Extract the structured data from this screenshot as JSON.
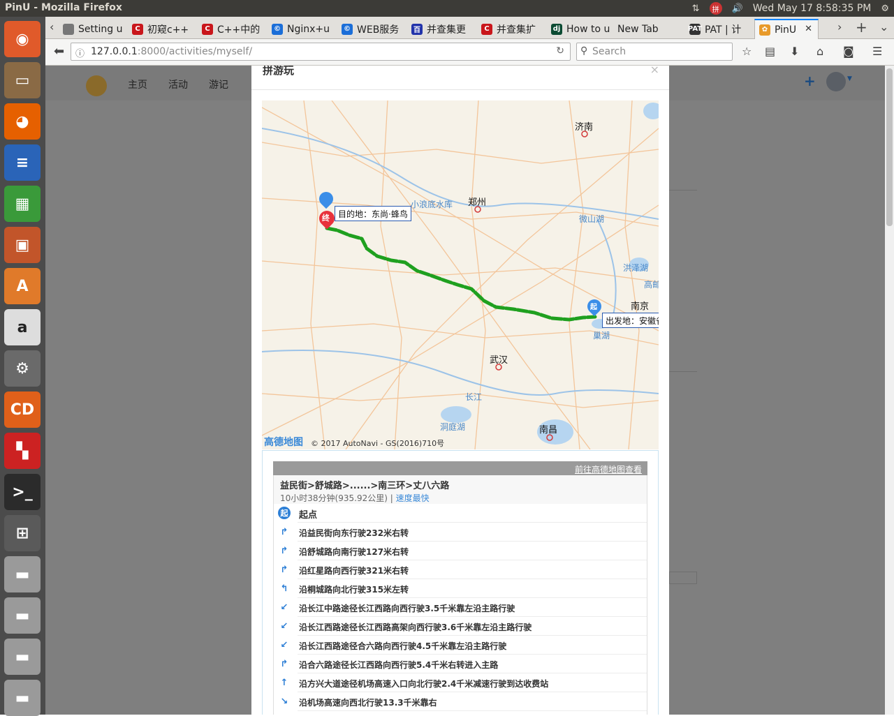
{
  "os": {
    "window_title": "PinU - Mozilla Firefox",
    "datetime": "Wed May 17  8:58:35 PM",
    "tray_icons": [
      "network-icon",
      "input-method-icon",
      "volume-icon",
      "settings-icon"
    ]
  },
  "launcher": {
    "items": [
      {
        "name": "ubuntu-dash-icon",
        "color": "#e05a2a"
      },
      {
        "name": "files-icon",
        "color": "#8a6a45"
      },
      {
        "name": "firefox-icon",
        "color": "#e66000"
      },
      {
        "name": "writer-icon",
        "color": "#2a64b8"
      },
      {
        "name": "calc-icon",
        "color": "#3a9a3a"
      },
      {
        "name": "impress-icon",
        "color": "#c2552a"
      },
      {
        "name": "software-center-icon",
        "color": "#e07a2a"
      },
      {
        "name": "amazon-icon",
        "color": "#dddddd"
      },
      {
        "name": "system-settings-icon",
        "color": "#6a6a6a"
      },
      {
        "name": "disc-icon",
        "color": "#e0601a"
      },
      {
        "name": "workspaces-icon",
        "color": "#cc2222"
      },
      {
        "name": "terminal-icon",
        "color": "#2b2b2b"
      },
      {
        "name": "workspace-switcher-icon",
        "color": "#5a5a5a"
      },
      {
        "name": "drive-icon",
        "color": "#9a9a9a"
      },
      {
        "name": "drive-icon",
        "color": "#9a9a9a"
      },
      {
        "name": "drive-icon",
        "color": "#9a9a9a"
      },
      {
        "name": "drive-icon",
        "color": "#9a9a9a"
      }
    ]
  },
  "browser": {
    "tabs": [
      {
        "label": "Setting u",
        "icon": "page-icon",
        "icon_color": "#777777",
        "active": false
      },
      {
        "label": "初窥c++",
        "icon": "csdn-icon",
        "icon_color": "#c9161b",
        "icon_text": "C",
        "active": false
      },
      {
        "label": "C++中的",
        "icon": "csdn-icon",
        "icon_color": "#c9161b",
        "icon_text": "C",
        "active": false
      },
      {
        "label": "Nginx+u",
        "icon": "blog-icon",
        "icon_color": "#1b6ed8",
        "icon_text": "©",
        "active": false
      },
      {
        "label": "WEB服务",
        "icon": "blog-icon",
        "icon_color": "#1b6ed8",
        "icon_text": "©",
        "active": false
      },
      {
        "label": "并查集更",
        "icon": "site-icon",
        "icon_color": "#2233aa",
        "icon_text": "百",
        "active": false
      },
      {
        "label": "并查集扩",
        "icon": "csdn-icon",
        "icon_color": "#c9161b",
        "icon_text": "C",
        "active": false
      },
      {
        "label": "How to u",
        "icon": "django-icon",
        "icon_color": "#0c4b33",
        "icon_text": "dj",
        "active": false
      },
      {
        "label": "New Tab",
        "icon": "",
        "icon_color": "",
        "icon_text": "",
        "active": false
      },
      {
        "label": "PAT | 计",
        "icon": "pat-icon",
        "icon_color": "#333333",
        "icon_text": "PAT",
        "active": false
      },
      {
        "label": "PinU",
        "icon": "pinu-icon",
        "icon_color": "#e89a2a",
        "icon_text": "✿",
        "active": true
      }
    ],
    "url_host": "127.0.0.1",
    "url_rest": ":8000/activities/myself/",
    "search_placeholder": "Search"
  },
  "site": {
    "nav": [
      "主页",
      "活动",
      "游记"
    ]
  },
  "modal": {
    "title": "拼游玩",
    "close": "×"
  },
  "map": {
    "cities": [
      {
        "name": "济南"
      },
      {
        "name": "郑州"
      },
      {
        "name": "南京"
      },
      {
        "name": "武汉"
      },
      {
        "name": "南昌"
      }
    ],
    "water": [
      "小浪底水库",
      "微山湖",
      "洪泽湖",
      "高邮",
      "巢湖",
      "长江",
      "洞庭湖"
    ],
    "destination_label": "目的地：东尚·蜂鸟",
    "origin_label": "出发地：安徽省",
    "end_marker": "终",
    "start_marker": "起",
    "attribution_logo": "高德地图",
    "attribution": "© 2017 AutoNavi - GS(2016)710号",
    "route_color": "#1fa01f"
  },
  "route": {
    "view_link": "前往高德地图查看",
    "path": "益民街>舒城路>......>南三环>丈八六路",
    "duration_distance": "10小时38分钟(935.92公里)",
    "policy": "速度最快",
    "steps": [
      {
        "icon": "start-icon",
        "text": "起点"
      },
      {
        "icon": "turn-right-icon",
        "text": "沿益民街向东行驶232米右转"
      },
      {
        "icon": "turn-right-icon",
        "text": "沿舒城路向南行驶127米右转"
      },
      {
        "icon": "turn-right-icon",
        "text": "沿红星路向西行驶321米右转"
      },
      {
        "icon": "turn-left-icon",
        "text": "沿桐城路向北行驶315米左转"
      },
      {
        "icon": "keep-left-icon",
        "text": "沿长江中路途径长江西路向西行驶3.5千米靠左沿主路行驶"
      },
      {
        "icon": "keep-left-icon",
        "text": "沿长江西路途径长江西路高架向西行驶3.6千米靠左沿主路行驶"
      },
      {
        "icon": "keep-left-icon",
        "text": "沿长江西路途径合六路向西行驶4.5千米靠左沿主路行驶"
      },
      {
        "icon": "turn-right-icon",
        "text": "沿合六路途径长江西路向西行驶5.4千米右转进入主路"
      },
      {
        "icon": "straight-icon",
        "text": "沿方兴大道途径机场高速入口向北行驶2.4千米减速行驶到达收费站"
      },
      {
        "icon": "keep-right-icon",
        "text": "沿机场高速向西北行驶13.3千米靠右"
      }
    ]
  }
}
